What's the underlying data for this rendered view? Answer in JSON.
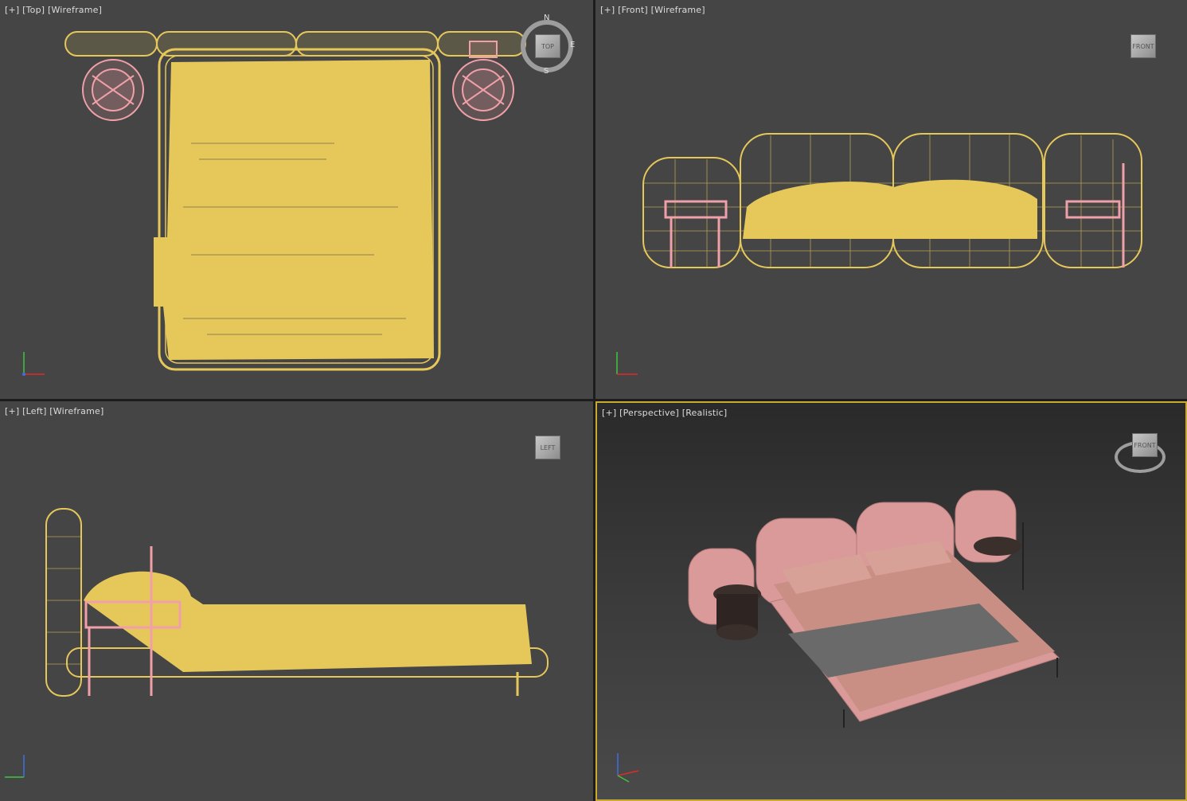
{
  "viewports": {
    "top": {
      "label_parts": [
        "[+]",
        "[Top]",
        "[Wireframe]"
      ],
      "viewcube_label": "TOP",
      "compass": {
        "n": "N",
        "e": "E",
        "s": "S"
      }
    },
    "front": {
      "label_parts": [
        "[+]",
        "[Front]",
        "[Wireframe]"
      ],
      "viewcube_label": "FRONT"
    },
    "left": {
      "label_parts": [
        "[+]",
        "[Left]",
        "[Wireframe]"
      ],
      "viewcube_label": "LEFT"
    },
    "perspective": {
      "label_parts": [
        "[+]",
        "[Perspective]",
        "[Realistic]"
      ],
      "viewcube_label": "FRONT",
      "active": true
    }
  },
  "colors": {
    "wire_bed": "#e6c75a",
    "wire_table": "#f0a0a8",
    "viewport_bg": "#454545",
    "active_border": "#c9a92e",
    "bed_pink": "#d99a99",
    "sheet": "#c98f84",
    "throw": "#6a6a6a",
    "table_dark": "#3a2f2b"
  },
  "icons": [
    "viewcube-icon",
    "compass-icon",
    "axis-tripod-icon"
  ]
}
